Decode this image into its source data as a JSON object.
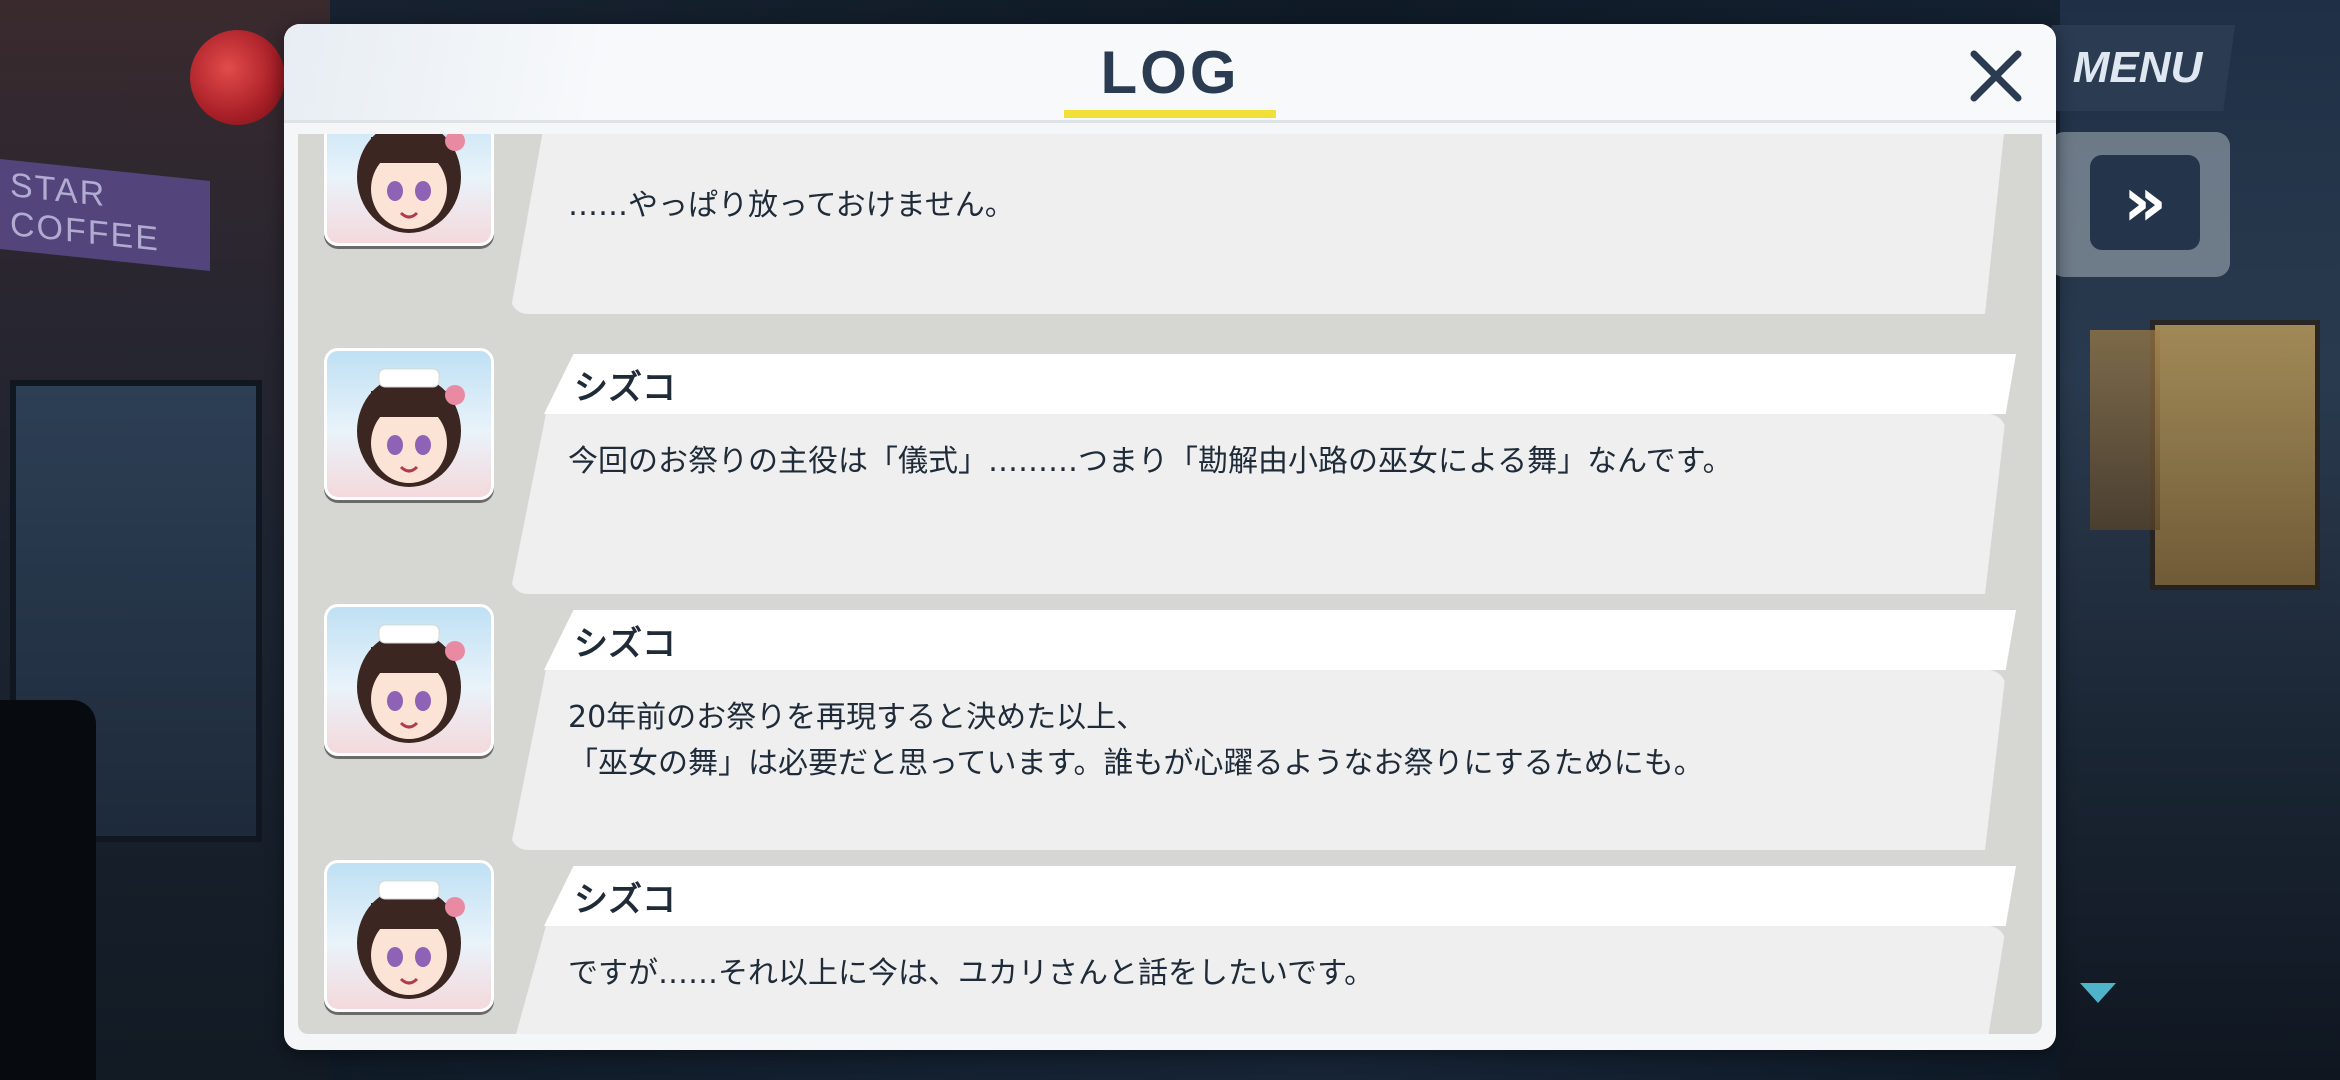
{
  "controls": {
    "menu_label": "MENU",
    "skip_glyph": "»",
    "skip_icon": "fast-forward-icon",
    "close_icon": "close-icon"
  },
  "log": {
    "title": "LOG",
    "entries": [
      {
        "speaker": "",
        "lines": [
          "……やっぱり放っておけません。"
        ]
      },
      {
        "speaker": "シズコ",
        "lines": [
          "今回のお祭りの主役は「儀式」………つまり「勘解由小路の巫女による舞」なんです。"
        ]
      },
      {
        "speaker": "シズコ",
        "lines": [
          "20年前のお祭りを再現すると決めた以上、",
          "「巫女の舞」は必要だと思っています。誰もが心躍るようなお祭りにするためにも。"
        ]
      },
      {
        "speaker": "シズコ",
        "lines": [
          "ですが……それ以上に今は、ユカリさんと話をしたいです。"
        ]
      }
    ]
  },
  "background": {
    "sign_text": "STAR COFFEE"
  },
  "colors": {
    "accent_yellow": "#f2e03a",
    "navy": "#2a3b52",
    "panel": "#d6d6d3",
    "bubble": "#efefef"
  }
}
